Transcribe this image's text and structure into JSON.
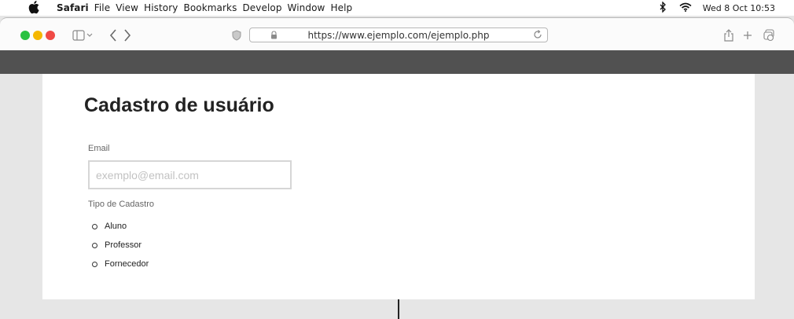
{
  "menubar": {
    "app_name": "Safari",
    "items": [
      "File",
      "View",
      "History",
      "Bookmarks",
      "Develop",
      "Window",
      "Help"
    ],
    "clock": "Wed 8 Oct  10:53",
    "icons": [
      "apple-logo-icon",
      "bluetooth-icon",
      "wifi-icon"
    ]
  },
  "browser": {
    "url": "https://www.ejemplo.com/ejemplo.php",
    "traffic_light_colors": [
      "#29c241",
      "#f5b700",
      "#f04a45"
    ],
    "toolbar_icons": [
      "sidebar-icon",
      "chevron-down-icon",
      "back-icon",
      "forward-icon",
      "shield-icon",
      "lock-icon",
      "reload-icon",
      "share-icon",
      "new-tab-icon",
      "tab-overview-icon"
    ]
  },
  "page": {
    "header_color": "#515151",
    "title": "Cadastro de usuário",
    "email": {
      "label": "Email",
      "placeholder": "exemplo@email.com",
      "value": ""
    },
    "tipo": {
      "label": "Tipo de Cadastro",
      "options": [
        "Aluno",
        "Professor",
        "Fornecedor"
      ]
    }
  }
}
